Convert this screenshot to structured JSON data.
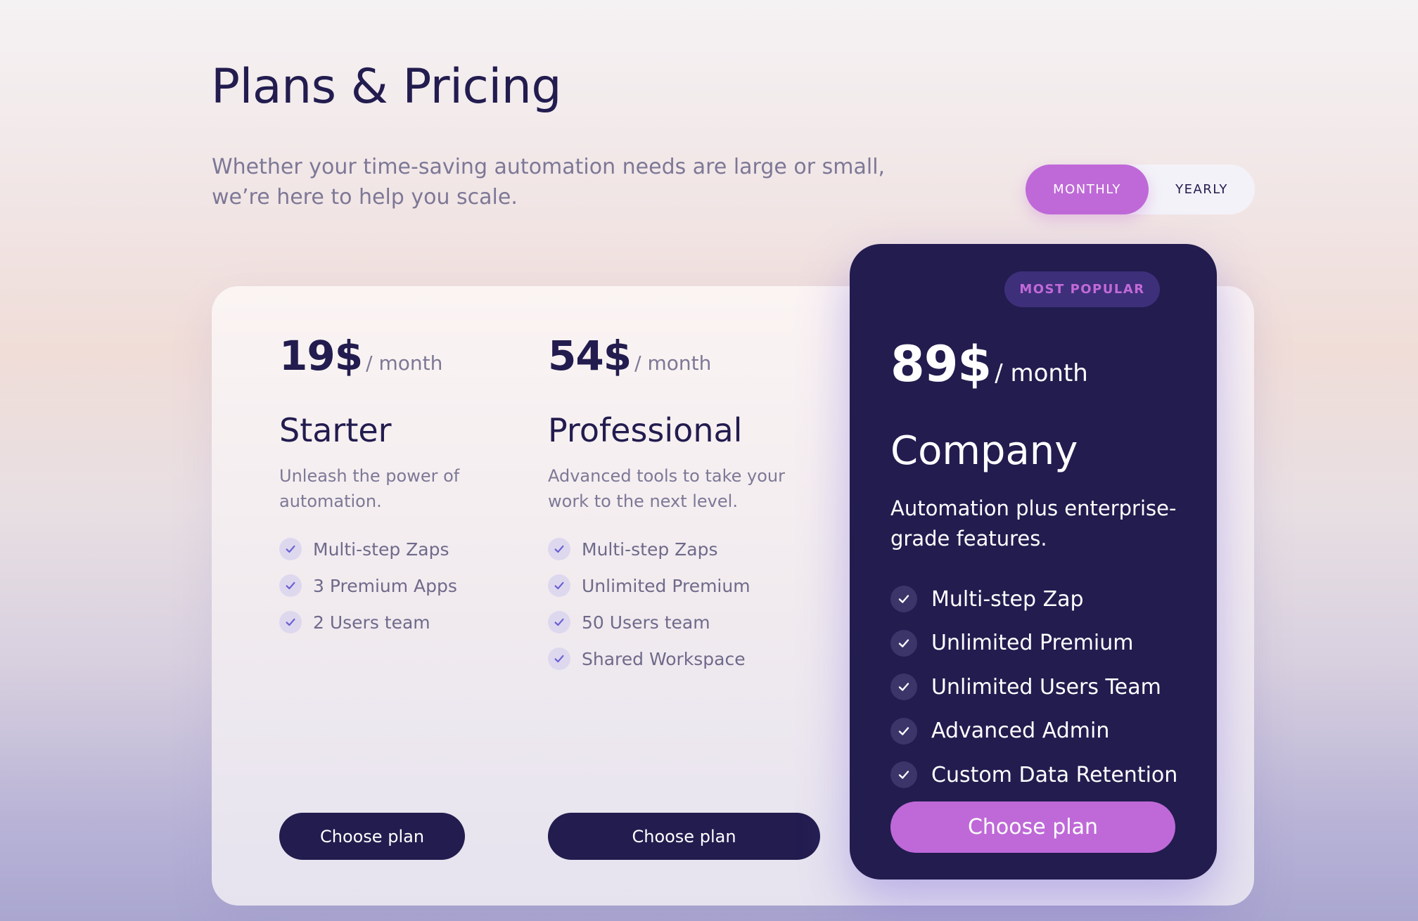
{
  "header": {
    "title": "Plans & Pricing",
    "subtitle": "Whether your time-saving automation needs are large or small, we’re here to help you scale."
  },
  "billing_toggle": {
    "options": [
      "MONTHLY",
      "YEARLY"
    ],
    "selected": "MONTHLY"
  },
  "plans": [
    {
      "price": "19$",
      "period": "/ month",
      "name": "Starter",
      "description": "Unleash the power of automation.",
      "features": [
        "Multi-step Zaps",
        "3 Premium Apps",
        "2 Users team"
      ],
      "button_label": "Choose plan"
    },
    {
      "price": "54$",
      "period": "/ month",
      "name": "Professional",
      "description": "Advanced tools to take your work to the next level.",
      "features": [
        "Multi-step Zaps",
        "Unlimited Premium",
        "50 Users team",
        "Shared Workspace"
      ],
      "button_label": "Choose plan"
    },
    {
      "badge": "MOST POPULAR",
      "price": "89$",
      "period": "/ month",
      "name": "Company",
      "description": "Automation plus enterprise-grade features.",
      "features": [
        "Multi-step Zap",
        "Unlimited Premium",
        "Unlimited Users Team",
        "Advanced Admin",
        "Custom Data Retention"
      ],
      "button_label": "Choose plan"
    }
  ],
  "icons": {
    "feature_check": "check-icon"
  },
  "colors": {
    "accent": "#bf69d8",
    "navy": "#221c4f",
    "muted_text": "#7d7896",
    "check_bg_light": "#ddd8ee",
    "check_color_light": "#6a5fd4"
  }
}
